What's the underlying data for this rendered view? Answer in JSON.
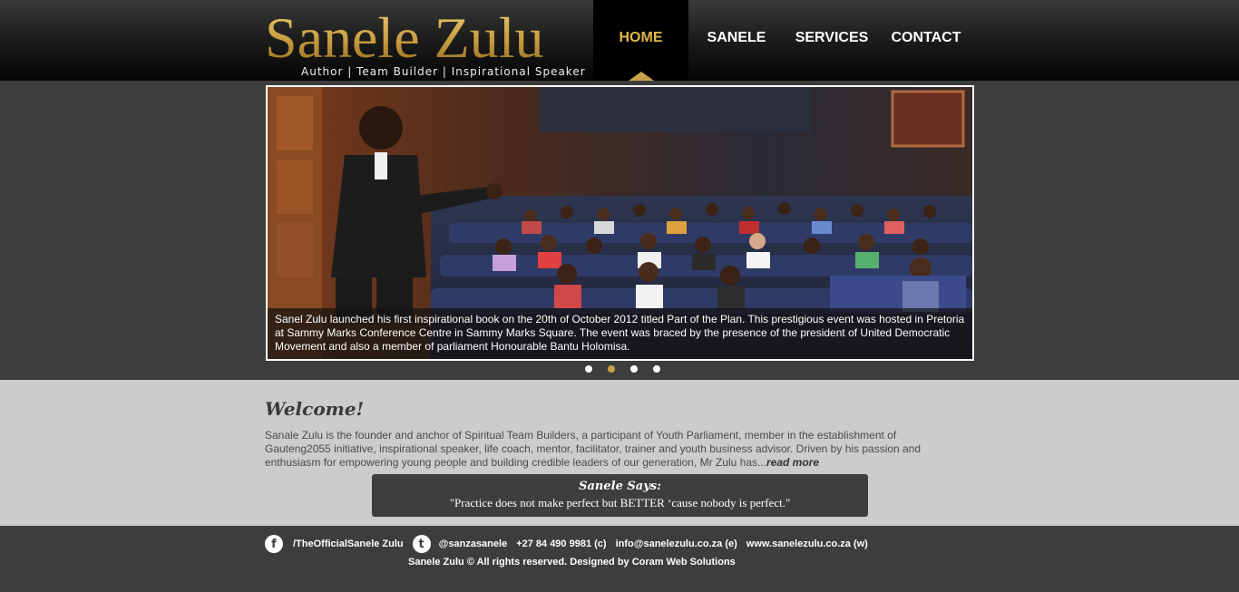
{
  "brand": {
    "name": "Sanele Zulu",
    "tagline": "Author | Team Builder | Inspirational Speaker"
  },
  "nav": {
    "items": [
      {
        "label": "HOME",
        "active": true
      },
      {
        "label": "SANELE",
        "active": false
      },
      {
        "label": "SERVICES",
        "active": false
      },
      {
        "label": "CONTACT",
        "active": false
      }
    ]
  },
  "slider": {
    "caption": "Sanel Zulu launched his first inspirational book on the 20th of October 2012 titled Part of the Plan. This prestigious event was hosted in Pretoria at Sammy Marks Conference Centre in Sammy Marks Square. The event was braced by the presence of the president of United Democratic Movement and also a member of parliament Honourable Bantu Holomisa.",
    "dot_count": 4,
    "active_dot": 2
  },
  "welcome": {
    "heading": "Welcome!",
    "text": "Sanale Zulu is the founder and anchor of Spiritual Team Builders, a participant of Youth Parliament, member in the establishment of Gauteng2055 initiative, inspirational speaker, life coach, mentor, facilitator, trainer and youth business advisor. Driven by his passion and enthusiasm for empowering young people and building credible leaders of our generation, Mr Zulu has...",
    "read_more": "read more"
  },
  "quote": {
    "title": "Sanele Says:",
    "text": "\"Practice does not make perfect but BETTER ‘cause nobody is perfect.\""
  },
  "footer": {
    "facebook_icon": "f",
    "facebook": "/TheOfficialSanele Zulu",
    "twitter_icon": "t",
    "twitter": "@sanzasanele",
    "phone": "+27 84 490 9981 (c)",
    "email": "info@sanelezulu.co.za (e)",
    "website": "www.sanelezulu.co.za (w)",
    "copyright": "Sanele Zulu © All rights reserved. Designed by Coram Web Solutions"
  },
  "colors": {
    "accent_gold": "#c9a24a",
    "header_bg": "#000000",
    "content_bg": "#cccccc",
    "footer_bg": "#3d3d3d"
  }
}
